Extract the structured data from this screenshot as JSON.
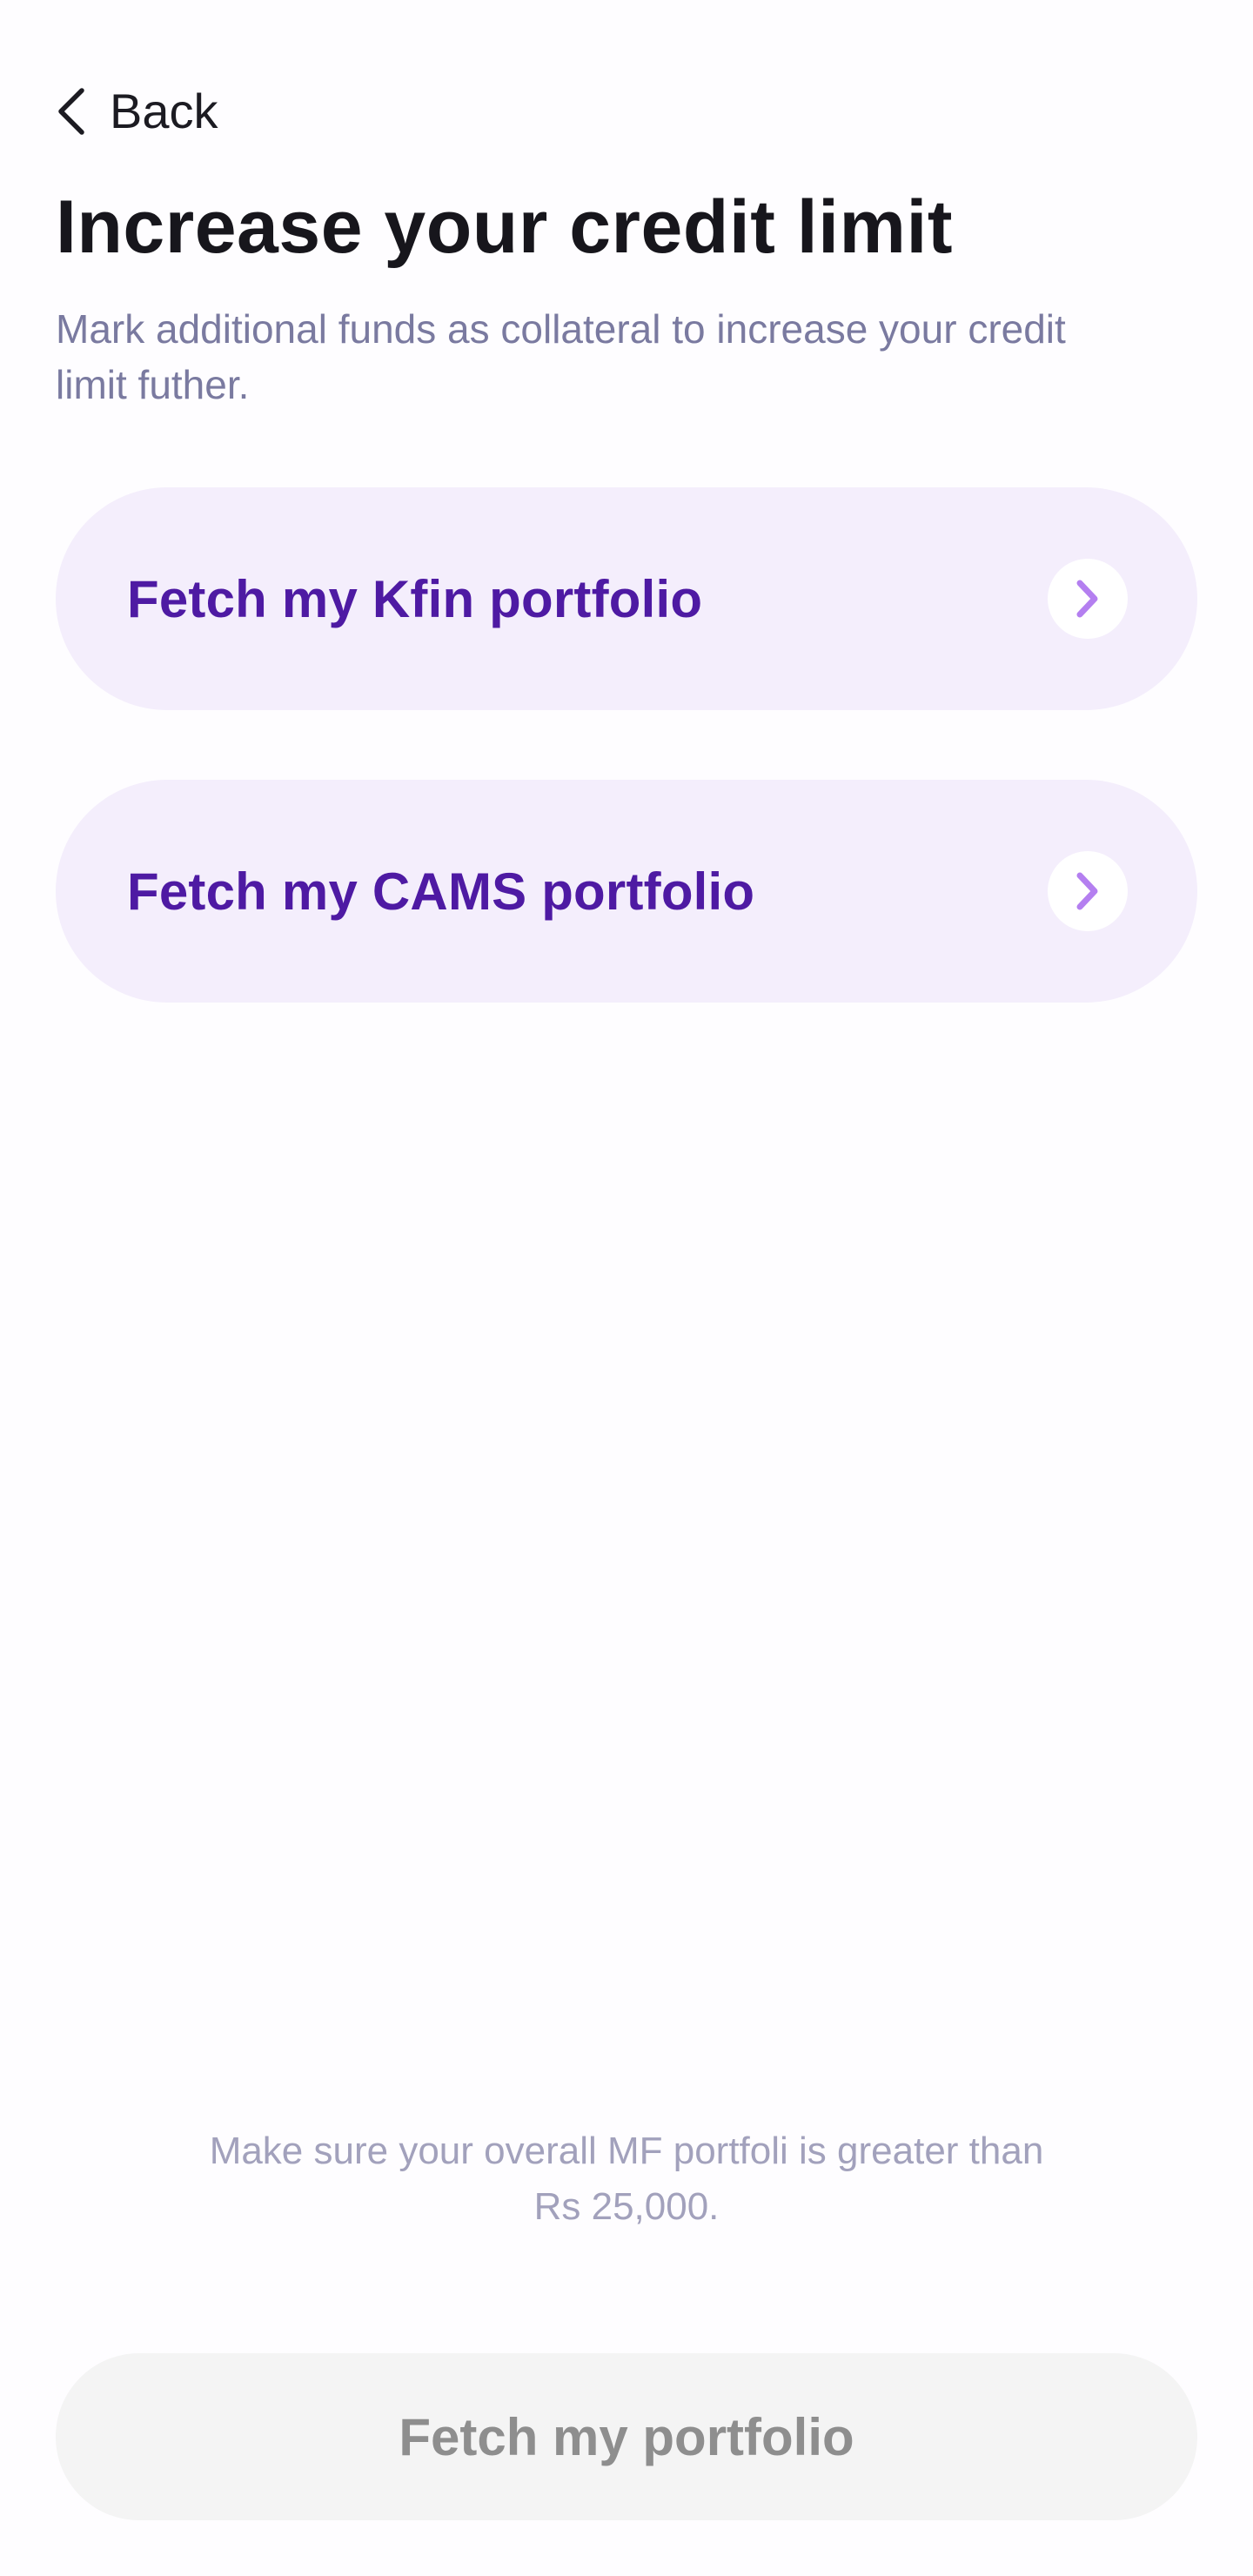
{
  "header": {
    "back_label": "Back",
    "back_icon": "chevron-left-icon"
  },
  "page": {
    "title": "Increase your credit limit",
    "subtitle": "Mark additional funds as collateral to increase your credit limit futher."
  },
  "options": [
    {
      "label": "Fetch my Kfin portfolio",
      "icon": "chevron-right-icon"
    },
    {
      "label": "Fetch my CAMS portfolio",
      "icon": "chevron-right-icon"
    }
  ],
  "footer": {
    "note": "Make sure your overall MF portfoli is greater than Rs 25,000.",
    "cta_label": "Fetch my portfolio",
    "cta_enabled": false
  },
  "colors": {
    "background": "#fefdff",
    "option_background": "#f4eefc",
    "option_text": "#4e1aa3",
    "chevron_accent": "#b47ff0",
    "subtitle_text": "#7a7aa0",
    "note_text": "#a2a1bc",
    "cta_background_disabled": "#f4f4f4",
    "cta_text_disabled": "#8e8e8e"
  }
}
